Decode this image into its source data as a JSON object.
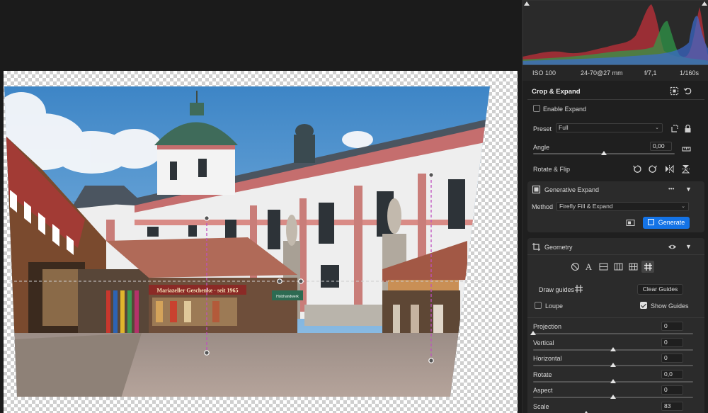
{
  "exif": {
    "iso": "ISO 100",
    "lens": "24-70@27 mm",
    "aperture": "f/7,1",
    "shutter": "1/160s"
  },
  "photo": {
    "sign_text": "Mariazeller Geschenke · seit 1965",
    "side_sign": "Holzhandwerk"
  },
  "crop": {
    "title": "Crop & Expand",
    "enable_expand": "Enable Expand",
    "preset_label": "Preset",
    "preset_value": "Full",
    "angle_label": "Angle",
    "angle_value": "0,00",
    "angle_level": 0.5,
    "rotate_flip_label": "Rotate & Flip"
  },
  "gen": {
    "title": "Generative Expand",
    "more": "•••",
    "method_label": "Method",
    "method_value": "Firefly Fill & Expand",
    "generate_label": "Generate"
  },
  "geometry": {
    "title": "Geometry",
    "draw_guides": "Draw guides",
    "clear_guides": "Clear Guides",
    "loupe": "Loupe",
    "show_guides": "Show Guides",
    "sliders": [
      {
        "label": "Projection",
        "value": "0",
        "level": 0.0
      },
      {
        "label": "Vertical",
        "value": "0",
        "level": 0.5
      },
      {
        "label": "Horizontal",
        "value": "0",
        "level": 0.5
      },
      {
        "label": "Rotate",
        "value": "0,0",
        "level": 0.5
      },
      {
        "label": "Aspect",
        "value": "0",
        "level": 0.5
      },
      {
        "label": "Scale",
        "value": "83",
        "level": 0.33
      }
    ]
  },
  "colors": {
    "accent": "#1473e6",
    "panel": "#2b2b2b",
    "guide": "#c04fc0"
  }
}
